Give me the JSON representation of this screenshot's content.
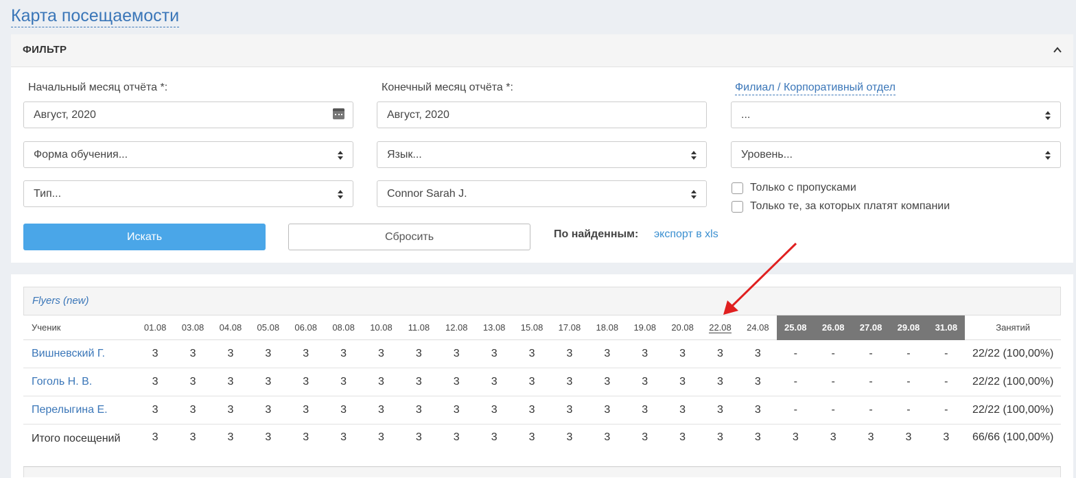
{
  "page_title": "Карта посещаемости",
  "filter": {
    "title": "ФИЛЬТР",
    "start_month_label": "Начальный месяц отчёта *:",
    "start_month_value": "Август, 2020",
    "end_month_label": "Конечный месяц отчёта *:",
    "end_month_value": "Август, 2020",
    "branch_label": "Филиал / Корпоративный отдел",
    "branch_value": "...",
    "form_value": "Форма обучения...",
    "language_value": "Язык...",
    "level_value": "Уровень...",
    "type_value": "Тип...",
    "teacher_value": "Connor Sarah J.",
    "only_absences_label": "Только с пропусками",
    "only_company_paid_label": "Только те, за которых платят компании",
    "search_button": "Искать",
    "reset_button": "Сбросить",
    "found_label": "По найденным:",
    "export_link": "экспорт в xls"
  },
  "table": {
    "group_name": "Flyers (new)",
    "student_header": "Ученик",
    "lessons_header": "Занятий",
    "dates": [
      "01.08",
      "03.08",
      "04.08",
      "05.08",
      "06.08",
      "08.08",
      "10.08",
      "11.08",
      "12.08",
      "13.08",
      "15.08",
      "17.08",
      "18.08",
      "19.08",
      "20.08",
      "22.08",
      "24.08",
      "25.08",
      "26.08",
      "27.08",
      "29.08",
      "31.08"
    ],
    "rows": [
      {
        "name": "Вишневский Г.",
        "values": [
          "3",
          "3",
          "3",
          "3",
          "3",
          "3",
          "3",
          "3",
          "3",
          "3",
          "3",
          "3",
          "3",
          "3",
          "3",
          "3",
          "3",
          "-",
          "-",
          "-",
          "-",
          "-"
        ],
        "summary": "22/22 (100,00%)"
      },
      {
        "name": "Гоголь Н. В.",
        "values": [
          "3",
          "3",
          "3",
          "3",
          "3",
          "3",
          "3",
          "3",
          "3",
          "3",
          "3",
          "3",
          "3",
          "3",
          "3",
          "3",
          "3",
          "-",
          "-",
          "-",
          "-",
          "-"
        ],
        "summary": "22/22 (100,00%)"
      },
      {
        "name": "Перелыгина Е.",
        "values": [
          "3",
          "3",
          "3",
          "3",
          "3",
          "3",
          "3",
          "3",
          "3",
          "3",
          "3",
          "3",
          "3",
          "3",
          "3",
          "3",
          "3",
          "-",
          "-",
          "-",
          "-",
          "-"
        ],
        "summary": "22/22 (100,00%)"
      }
    ],
    "total": {
      "name": "Итого посещений",
      "values": [
        "3",
        "3",
        "3",
        "3",
        "3",
        "3",
        "3",
        "3",
        "3",
        "3",
        "3",
        "3",
        "3",
        "3",
        "3",
        "3",
        "3",
        "3",
        "3",
        "3",
        "3",
        "3"
      ],
      "summary": "66/66 (100,00%)"
    }
  },
  "colors": {
    "accent": "#3a76b8",
    "primary_button": "#4aa6e8",
    "dark_header": "#777777",
    "annotation_arrow": "#e02020"
  }
}
